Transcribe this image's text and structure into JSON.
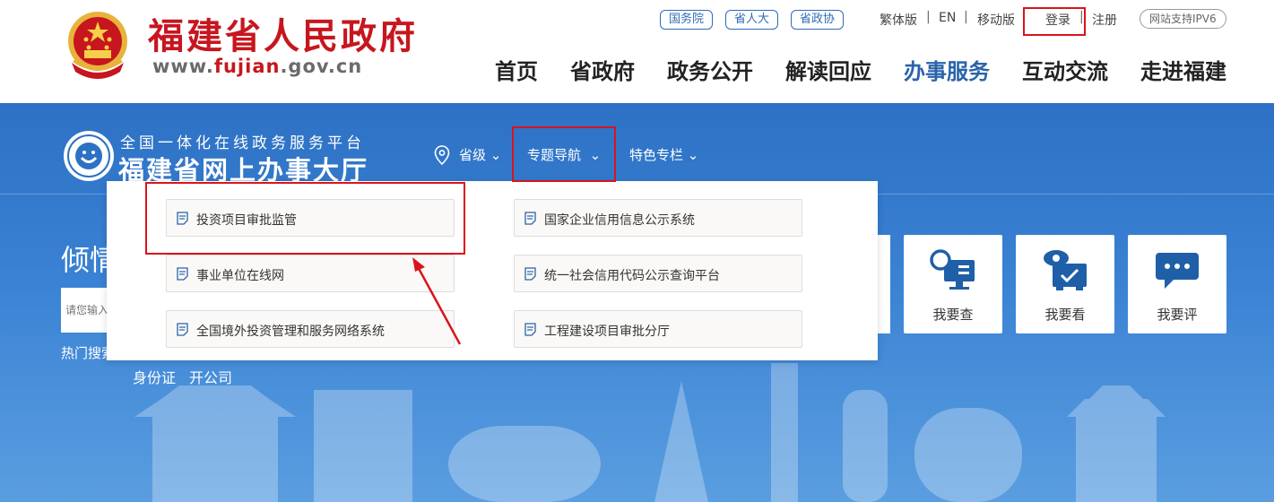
{
  "header": {
    "site_title": "福建省人民政府",
    "url_prefix": "www.",
    "url_highlight": "fujian",
    "url_suffix": ".gov.cn",
    "tags": [
      "国务院",
      "省人大",
      "省政协"
    ],
    "top_links": {
      "traditional": "繁体版",
      "english": "EN",
      "mobile": "移动版",
      "login": "登录",
      "register": "注册"
    },
    "ipv6": "网站支持IPV6",
    "nav": [
      "首页",
      "省政府",
      "政务公开",
      "解读回应",
      "办事服务",
      "互动交流",
      "走进福建"
    ],
    "active_nav": "办事服务"
  },
  "hall": {
    "subtitle": "全国一体化在线政务服务平台",
    "title": "福建省网上办事大厅",
    "subnav": {
      "province": "省级",
      "topic_nav": "专题导航",
      "feature": "特色专栏"
    }
  },
  "hero": {
    "text_partial": "倾情",
    "search_placeholder": "请您输入",
    "hot_label": "热门搜索",
    "hot_links": [
      "身份证",
      "开公司"
    ]
  },
  "services": [
    {
      "label": "我要查",
      "icon": "search-monitor-icon"
    },
    {
      "label": "我要看",
      "icon": "eye-check-icon"
    },
    {
      "label": "我要评",
      "icon": "chat-bubble-icon"
    }
  ],
  "dropdown": {
    "left": [
      "投资项目审批监管",
      "事业单位在线网",
      "全国境外投资管理和服务网络系统"
    ],
    "right": [
      "国家企业信用信息公示系统",
      "统一社会信用代码公示查询平台",
      "工程建设项目审批分厅"
    ]
  },
  "colors": {
    "brand_red": "#c7161e",
    "nav_active": "#2a63aa",
    "blue_bg": "#2d71c4",
    "annotation_red": "#d9141c"
  }
}
